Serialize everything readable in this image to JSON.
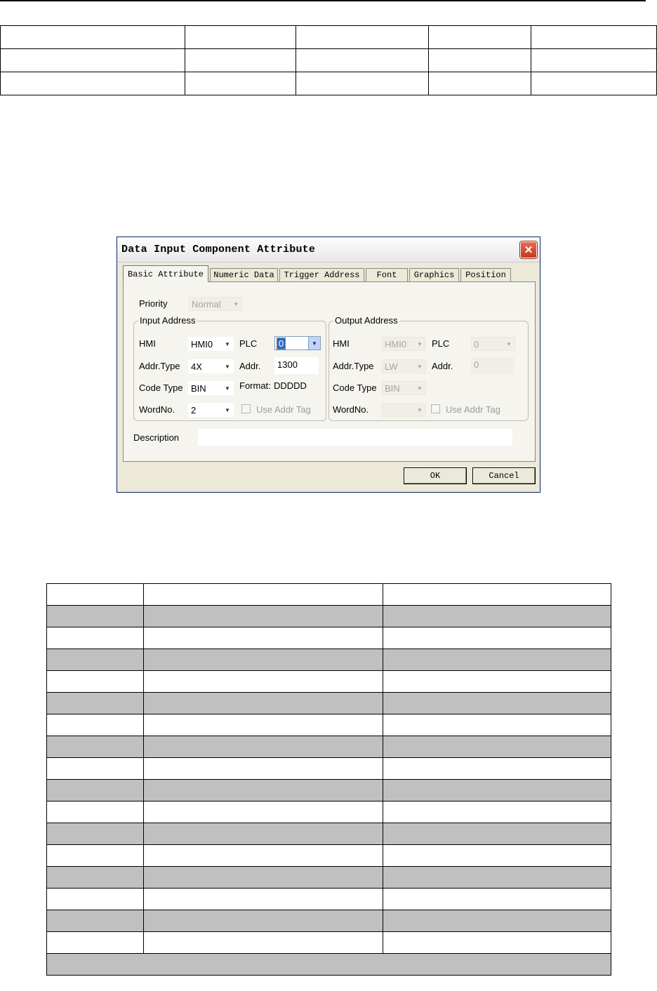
{
  "dialog": {
    "title": "Data Input Component Attribute",
    "close_label": "✕",
    "tabs": [
      {
        "label": "Basic Attribute",
        "active": true
      },
      {
        "label": "Numeric Data",
        "active": false
      },
      {
        "label": "Trigger Address",
        "active": false
      },
      {
        "label": "Font",
        "active": false
      },
      {
        "label": "Graphics",
        "active": false
      },
      {
        "label": "Position",
        "active": false
      }
    ],
    "priority": {
      "label": "Priority",
      "value": "Normal"
    },
    "input_address": {
      "legend": "Input Address",
      "hmi_label": "HMI",
      "hmi_value": "HMI0",
      "plc_label": "PLC",
      "plc_value": "0",
      "addr_type_label": "Addr.Type",
      "addr_type_value": "4X",
      "addr_label": "Addr.",
      "addr_value": "1300",
      "code_type_label": "Code Type",
      "code_type_value": "BIN",
      "format_label": "Format:",
      "format_value": "DDDDD",
      "wordno_label": "WordNo.",
      "wordno_value": "2",
      "use_addr_tag_label": "Use Addr Tag"
    },
    "output_address": {
      "legend": "Output Address",
      "hmi_label": "HMI",
      "hmi_value": "HMI0",
      "plc_label": "PLC",
      "plc_value": "0",
      "addr_type_label": "Addr.Type",
      "addr_type_value": "LW",
      "addr_label": "Addr.",
      "addr_value": "0",
      "code_type_label": "Code Type",
      "code_type_value": "BIN",
      "wordno_label": "WordNo.",
      "wordno_value": "",
      "use_addr_tag_label": "Use Addr Tag"
    },
    "description": {
      "label": "Description",
      "value": ""
    },
    "ok_label": "OK",
    "cancel_label": "Cancel"
  }
}
